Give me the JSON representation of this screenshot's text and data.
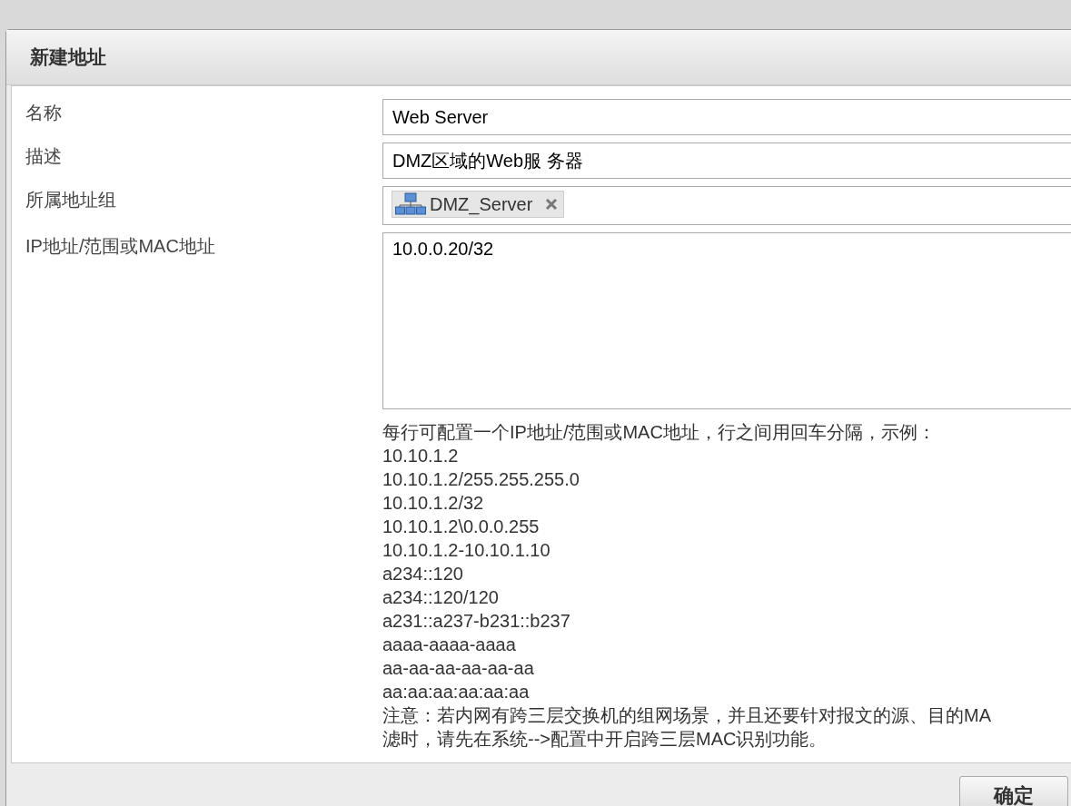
{
  "dialog": {
    "title": "新建地址"
  },
  "fields": [
    {
      "kind": "input",
      "label": "名称",
      "value": "Web Server"
    },
    {
      "kind": "input",
      "label": "描述",
      "value": "DMZ区域的Web服 务器"
    },
    {
      "kind": "tags",
      "label": "所属地址组",
      "tags": [
        "DMZ_Server"
      ]
    },
    {
      "kind": "textarea",
      "label": "IP地址/范围或MAC地址",
      "value": "10.0.0.20/32"
    }
  ],
  "hint_lines": [
    "每行可配置一个IP地址/范围或MAC地址，行之间用回车分隔，示例：",
    "10.10.1.2",
    "10.10.1.2/255.255.255.0",
    "10.10.1.2/32",
    "10.10.1.2\\0.0.0.255",
    "10.10.1.2-10.10.1.10",
    "a234::120",
    "a234::120/120",
    "a231::a237-b231::b237",
    "aaaa-aaaa-aaaa",
    "aa-aa-aa-aa-aa-aa",
    "aa:aa:aa:aa:aa:aa",
    "注意：若内网有跨三层交换机的组网场景，并且还要针对报文的源、目的MA",
    "滤时，请先在系统-->配置中开启跨三层MAC识别功能。"
  ],
  "buttons": [
    "确定"
  ]
}
